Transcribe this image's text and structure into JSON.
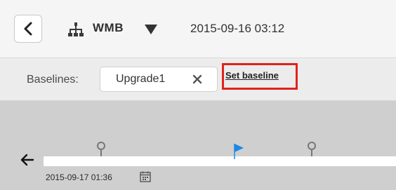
{
  "header": {
    "back_icon": "chevron-left-icon",
    "hierarchy_icon": "hierarchy-icon",
    "system_name": "WMB",
    "dropdown_icon": "caret-down-icon",
    "datetime": "2015-09-16 03:12"
  },
  "baselines": {
    "label": "Baselines:",
    "chips": [
      {
        "label": "Upgrade1",
        "remove_icon": "close-icon"
      }
    ],
    "set_link": "Set baseline",
    "highlight_color": "#e0231b"
  },
  "timeline": {
    "nav_icon": "arrow-left-icon",
    "markers": [
      {
        "type": "pin",
        "icon": "location-pin-icon"
      },
      {
        "type": "flag",
        "icon": "flag-icon",
        "color": "#1e88e5"
      },
      {
        "type": "pin",
        "icon": "location-pin-icon"
      }
    ],
    "date": "2015-09-17 01:36",
    "calendar_icon": "calendar-icon"
  }
}
